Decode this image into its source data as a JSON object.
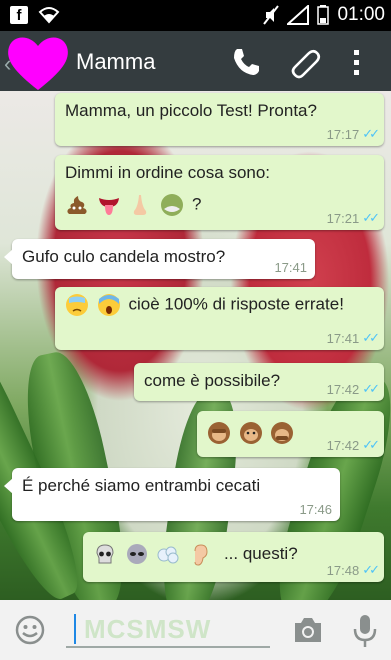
{
  "status_bar": {
    "time": "01:00"
  },
  "header": {
    "contact_name": "Mamma"
  },
  "messages": [
    {
      "dir": "out",
      "text": "Mamma, un piccolo Test! Pronta?",
      "time": "17:17"
    },
    {
      "dir": "out",
      "text": "Dimmi in ordine cosa sono:",
      "line2_suffix": "?",
      "time": "17:21"
    },
    {
      "dir": "in",
      "text": "Gufo culo candela mostro?",
      "time": "17:41"
    },
    {
      "dir": "out",
      "text": "cioè 100% di risposte errate!",
      "time": "17:41"
    },
    {
      "dir": "out",
      "text": "come è possibile?",
      "time": "17:42"
    },
    {
      "dir": "out",
      "text": "",
      "time": "17:42"
    },
    {
      "dir": "in",
      "text": "É perché siamo entrambi cecati",
      "time": "17:46"
    },
    {
      "dir": "out",
      "text": "... questi?",
      "time": "17:48"
    }
  ],
  "input": {
    "watermark": "MCSMSW"
  },
  "colors": {
    "header": "#343c3f",
    "outgoing_bubble": "#e2f7cb",
    "incoming_bubble": "#ffffff",
    "read_ticks": "#4fc3f7",
    "avatar_heart": "#ff00ff"
  }
}
